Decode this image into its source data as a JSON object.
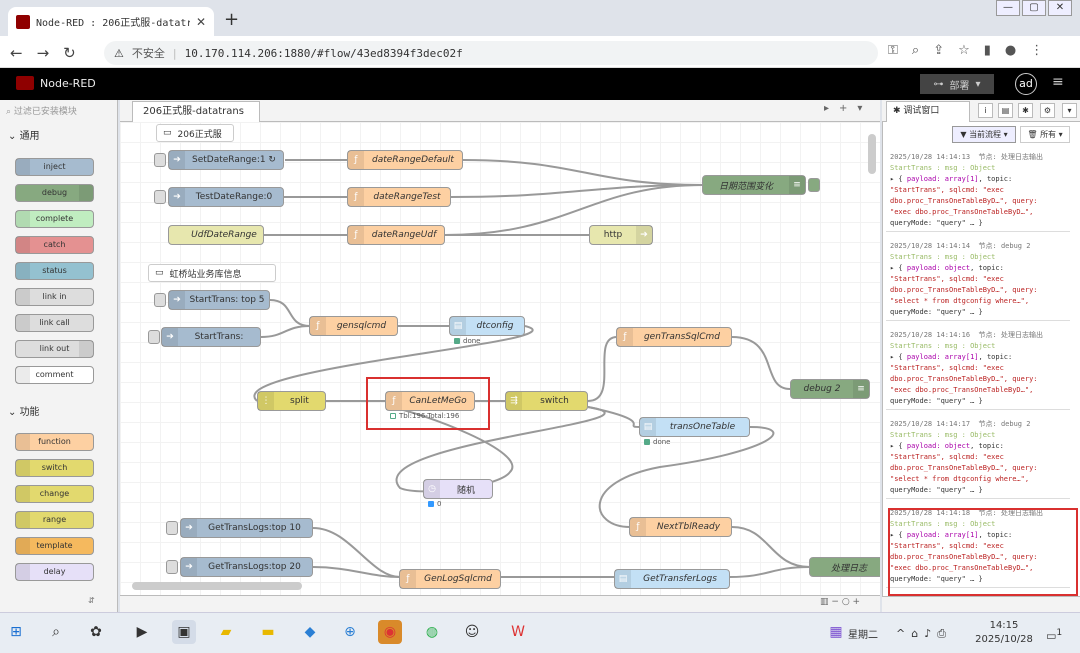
{
  "browser": {
    "tab_title": "Node-RED : 206正式服-datatrans",
    "close": "✕",
    "new_tab": "+",
    "security": "不安全",
    "url": "10.170.114.206:1880/#flow/43ed8394f3dec02f",
    "win_buttons": [
      "—",
      "▢",
      "✕"
    ]
  },
  "header": {
    "app_title": "Node-RED",
    "deploy_label": "部署",
    "user_initials": "ad"
  },
  "palette": {
    "search_placeholder": "过滤已安装模块",
    "category_common": "通用",
    "common_nodes": [
      "inject",
      "debug",
      "complete",
      "catch",
      "status",
      "link in",
      "link call",
      "link out",
      "comment"
    ],
    "category_function": "功能",
    "function_nodes": [
      "function",
      "switch",
      "change",
      "range",
      "template",
      "delay"
    ]
  },
  "workspace": {
    "tab_label": "206正式服-datatrans",
    "nodes": {
      "comment1": "206正式服",
      "n_setdate": "SetDateRange:1 ↻",
      "n_daterangedefault": "dateRangeDefault",
      "n_testdate": "TestDateRange:0",
      "n_daterangetest": "dateRangeTest",
      "n_udfdate": "UdfDateRange",
      "n_daterangeudf": "dateRangeUdf",
      "n_http": "http",
      "n_daterangechange": "日期范围变化",
      "comment2": "虹桥站业务库信息",
      "n_starttop5": "StartTrans: top 5",
      "n_starttrans": "StartTrans:",
      "n_gensqlcmd": "gensqlcmd",
      "n_dtconfig": "dtconfig",
      "n_dtconfig_status": "done",
      "n_gentranssqlcmd": "genTransSqlCmd",
      "n_debug2": "debug 2",
      "n_split": "split",
      "n_canletmego": "CanLetMeGo",
      "n_canletmego_status": "Tbl:196-Total:196",
      "n_switch": "switch",
      "n_transone": "transOneTable",
      "n_transone_status": "done",
      "n_random": "随机",
      "n_random_status": "0",
      "n_nexttbl": "NextTblReady",
      "n_getlogs10": "GetTransLogs:top 10",
      "n_getlogs20": "GetTransLogs:top 20",
      "n_genlogsql": "GenLogSqlcmd",
      "n_gettransferlogs": "GetTransferLogs",
      "n_processlog": "处理日志"
    }
  },
  "sidebar": {
    "tab_label": "调试窗口",
    "filter_current": "当前流程",
    "filter_all": "所有",
    "messages": [
      {
        "time": "2025/10/28 14:14:13",
        "node": "节点: 处理日志输出",
        "topic": "StartTrans : msg : Object",
        "payload": "payload: array[1]",
        "l1": "\"StartTrans\", sqlcmd: \"exec",
        "l2": "dbo.proc_TransOneTableByD…\", query:",
        "l3": "\"exec dbo.proc_TransOneTableByD…\",",
        "l4": "queryMode: \"query\" … }"
      },
      {
        "time": "2025/10/28 14:14:14",
        "node": "节点: debug 2",
        "topic": "StartTrans : msg : Object",
        "payload": "payload: object",
        "l1": "\"StartTrans\", sqlcmd: \"exec",
        "l2": "dbo.proc_TransOneTableByD…\", query:",
        "l3": "\"select  * from dtgconfig where…\",",
        "l4": "queryMode: \"query\" … }"
      },
      {
        "time": "2025/10/28 14:14:16",
        "node": "节点: 处理日志输出",
        "topic": "StartTrans : msg : Object",
        "payload": "payload: array[1]",
        "l1": "\"StartTrans\", sqlcmd: \"exec",
        "l2": "dbo.proc_TransOneTableByD…\", query:",
        "l3": "\"exec dbo.proc_TransOneTableByD…\",",
        "l4": "queryMode: \"query\" … }"
      },
      {
        "time": "2025/10/28 14:14:17",
        "node": "节点: debug 2",
        "topic": "StartTrans : msg : Object",
        "payload": "payload: object",
        "l1": "\"StartTrans\", sqlcmd: \"exec",
        "l2": "dbo.proc_TransOneTableByD…\", query:",
        "l3": "\"select  * from dtgconfig where…\",",
        "l4": "queryMode: \"query\" … }"
      },
      {
        "time": "2025/10/28 14:14:18",
        "node": "节点: 处理日志输出",
        "topic": "StartTrans : msg : Object",
        "payload": "payload: array[1]",
        "l1": "\"StartTrans\", sqlcmd: \"exec",
        "l2": "dbo.proc_TransOneTableByD…\", query:",
        "l3": "\"exec dbo.proc_TransOneTableByD…\",",
        "l4": "queryMode: \"query\" … }"
      }
    ]
  },
  "taskbar": {
    "weekday": "星期二",
    "time": "14:15",
    "date": "2025/10/28",
    "notify_count": "1"
  },
  "colors": {
    "inject": "#a6bbcf",
    "function": "#fdd0a2",
    "debug": "#87a980",
    "switch": "#e2d96e",
    "http": "#e7e7ae",
    "highlight": "#d9302f"
  }
}
